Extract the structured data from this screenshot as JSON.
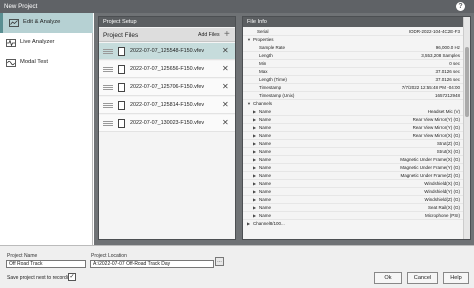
{
  "window": {
    "title": "New Project",
    "help_icon": "help-icon"
  },
  "sidebar": {
    "items": [
      {
        "label": "Edit & Analyze",
        "icon": "edit-analyze-icon",
        "active": true
      },
      {
        "label": "Live Analyzer",
        "icon": "live-analyzer-icon",
        "active": false
      },
      {
        "label": "Modal Test",
        "icon": "modal-test-icon",
        "active": false
      }
    ]
  },
  "project_setup": {
    "header": "Project Setup",
    "files_label": "Project Files",
    "add_files_label": "Add Files",
    "files": [
      "2022-07-07_125548-F150.vfev",
      "2022-07-07_125656-F150.vfev",
      "2022-07-07_125706-F150.vfev",
      "2022-07-07_125814-F150.vfev",
      "2022-07-07_130023-F150.vfev"
    ]
  },
  "file_info": {
    "header": "File Info",
    "top_row": {
      "key": "Serial",
      "value": "IODR-2022-104-4C2E-F3"
    },
    "properties_label": "Properties",
    "properties": [
      {
        "key": "Sample Rate",
        "value": "96,000.0 Hz"
      },
      {
        "key": "Length",
        "value": "3,553,208 Samples"
      },
      {
        "key": "Min",
        "value": "0 sec"
      },
      {
        "key": "Max",
        "value": "37.0126 sec"
      },
      {
        "key": "Length (Time)",
        "value": "37.0126 sec"
      },
      {
        "key": "Timestamp",
        "value": "7/7/2022 12:55:48 PM -04:00"
      },
      {
        "key": "Timestamp (Unix)",
        "value": "1657212948"
      }
    ],
    "channels_label": "Channels",
    "channel_key": "Name",
    "channels": [
      "Headset Mic (V)",
      "Rear View Mirror(Y) (G)",
      "Rear View Mirror(Y) (G)",
      "Rear View Mirror(X) (G)",
      "Strut(Z) (G)",
      "Strut(X) (G)",
      "Magnetic Under Frame(X) (G)",
      "Magnetic Under Frame(Y) (G)",
      "Magnetic Under Frame(Z) (G)",
      "Windshield(X) (G)",
      "Windshield(Y) (G)",
      "Windshield(Z) (G)",
      "Seat Rail(X) (G)",
      "Microphone (PSI)"
    ],
    "bottom_cut_label": "Channel8/100..."
  },
  "footer": {
    "project_name_label": "Project Name",
    "project_name_value": "Off Road Track",
    "project_location_label": "Project Location",
    "project_location_value": "A:\\2022-07-07 Off-Road Track Day",
    "browse_icon": "…",
    "save_next_label": "Save project next to recording",
    "save_next_checked": "✓",
    "ok_label": "Ok",
    "cancel_label": "Cancel",
    "help_label": "Help"
  }
}
